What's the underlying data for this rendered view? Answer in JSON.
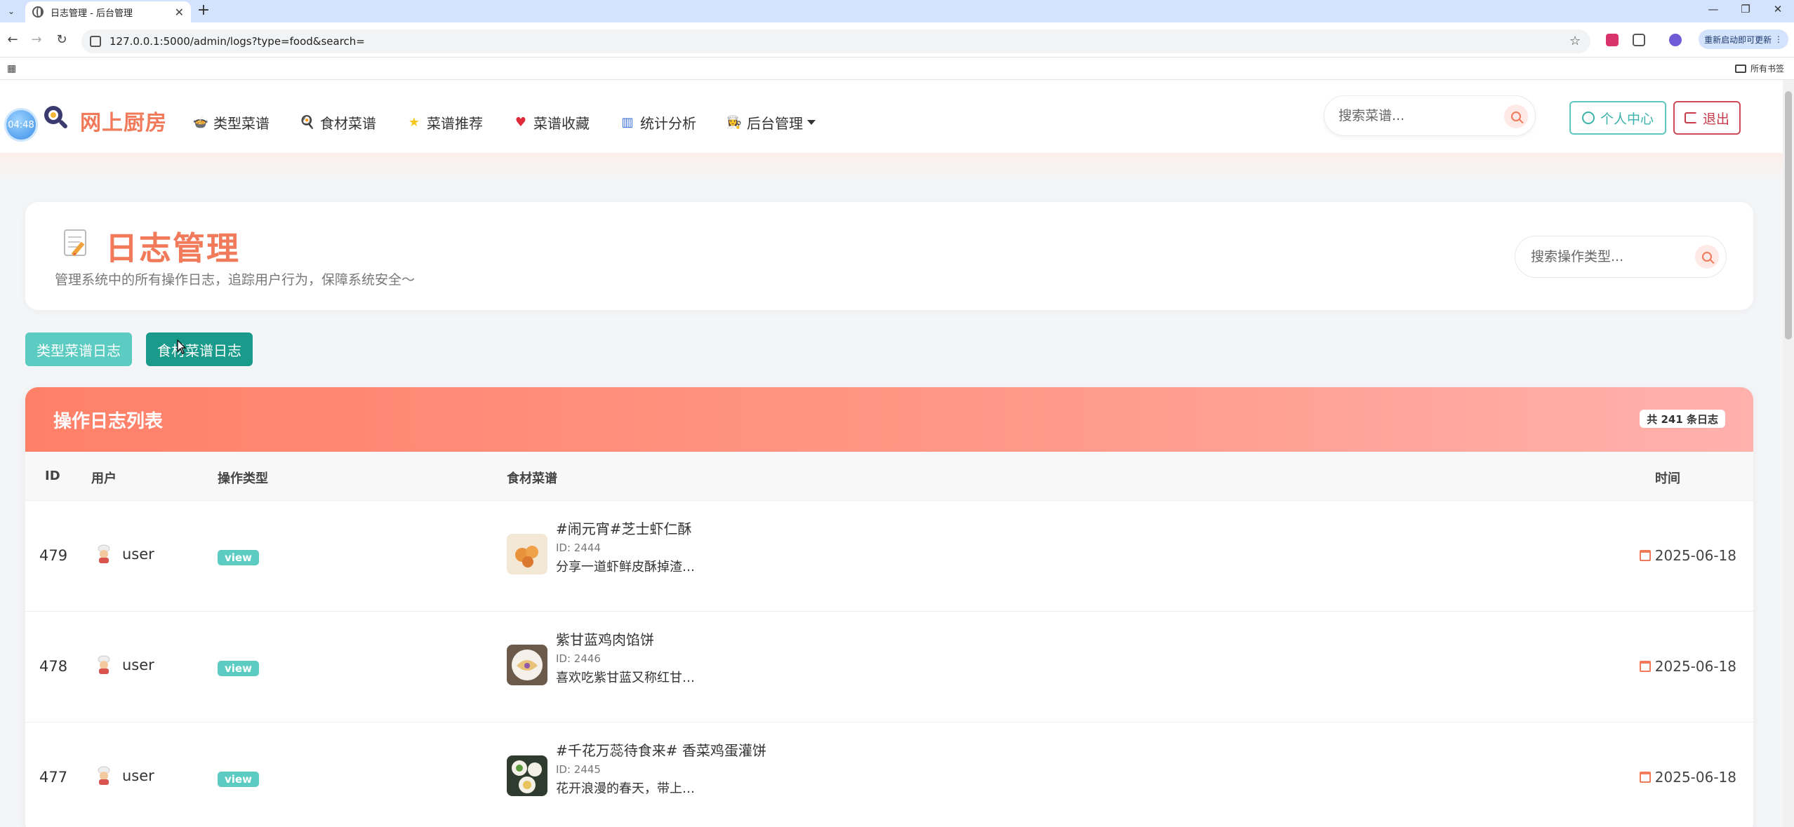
{
  "browser": {
    "tab_title": "日志管理 - 后台管理",
    "url": "127.0.0.1:5000/admin/logs?type=food&search=",
    "update_label": "重新启动即可更新",
    "bookmarks_label": "所有书签"
  },
  "nav": {
    "clock": "04:48",
    "brand": "网上厨房",
    "menu": [
      {
        "label": "类型菜谱",
        "icon": "pot-icon"
      },
      {
        "label": "食材菜谱",
        "icon": "pan-icon"
      },
      {
        "label": "菜谱推荐",
        "icon": "star-icon"
      },
      {
        "label": "菜谱收藏",
        "icon": "heart-icon"
      },
      {
        "label": "统计分析",
        "icon": "bar-chart-icon"
      },
      {
        "label": "后台管理",
        "icon": "chef-icon"
      }
    ],
    "search_placeholder": "搜索菜谱...",
    "profile_label": "个人中心",
    "logout_label": "退出"
  },
  "header": {
    "title": "日志管理",
    "subtitle": "管理系统中的所有操作日志，追踪用户行为，保障系统安全～",
    "search_placeholder": "搜索操作类型..."
  },
  "filters": {
    "type_logs": "类型菜谱日志",
    "food_logs": "食材菜谱日志"
  },
  "table": {
    "title": "操作日志列表",
    "count": "共 241 条日志",
    "columns": {
      "id": "ID",
      "user": "用户",
      "action": "操作类型",
      "recipe": "食材菜谱",
      "time": "时间"
    },
    "rows": [
      {
        "id": "479",
        "user": "user",
        "action": "view",
        "recipe_name": "#闹元宵#芝士虾仁酥",
        "recipe_id": "ID: 2444",
        "recipe_desc": "分享一道虾鲜皮酥掉渣…",
        "time": "2025-06-18"
      },
      {
        "id": "478",
        "user": "user",
        "action": "view",
        "recipe_name": "紫甘蓝鸡肉馅饼",
        "recipe_id": "ID: 2446",
        "recipe_desc": "喜欢吃紫甘蓝又称红甘…",
        "time": "2025-06-18"
      },
      {
        "id": "477",
        "user": "user",
        "action": "view",
        "recipe_name": "#千花万蕊待食来# 香菜鸡蛋灌饼",
        "recipe_id": "ID: 2445",
        "recipe_desc": "花开浪漫的春天，带上…",
        "time": "2025-06-18"
      }
    ]
  },
  "colors": {
    "accent": "#f07a5a",
    "teal": "#5ccbc2",
    "teal_dark": "#1a9a8a",
    "logout": "#c63a4a"
  }
}
